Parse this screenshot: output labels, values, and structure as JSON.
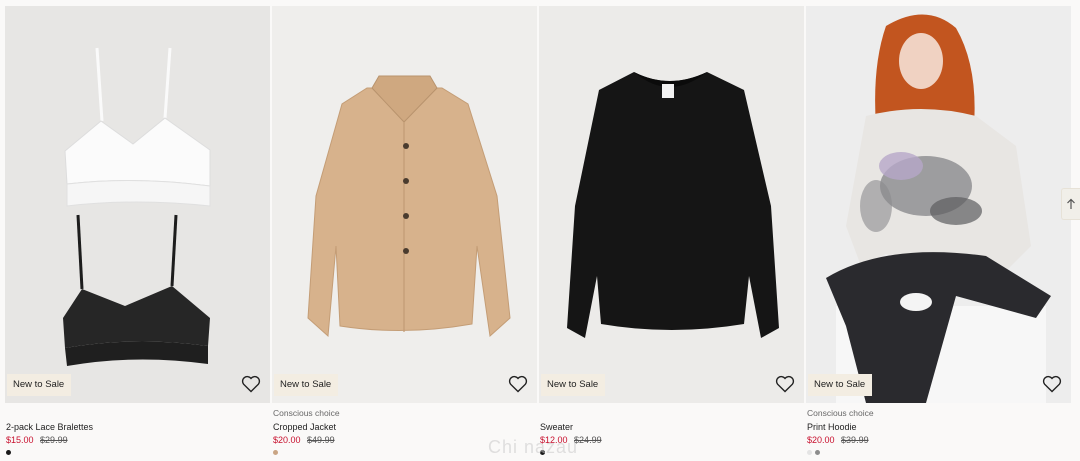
{
  "products": [
    {
      "badge": "New to Sale",
      "tag": "",
      "name": "2-pack Lace Bralettes",
      "price": "$15.00",
      "old_price": "$29.99",
      "swatches": [
        "#1a1a1a"
      ],
      "image_bg": "#e7e6e4"
    },
    {
      "badge": "New to Sale",
      "tag": "Conscious choice",
      "name": "Cropped Jacket",
      "price": "$20.00",
      "old_price": "$49.99",
      "swatches": [
        "#c9a584"
      ],
      "image_bg": "#efeeec"
    },
    {
      "badge": "New to Sale",
      "tag": "",
      "name": "Sweater",
      "price": "$12.00",
      "old_price": "$24.99",
      "swatches": [
        "#1a1a1a"
      ],
      "image_bg": "#ecebe9"
    },
    {
      "badge": "New to Sale",
      "tag": "Conscious choice",
      "name": "Print Hoodie",
      "price": "$20.00",
      "old_price": "$39.99",
      "swatches": [
        "#e4e4e4",
        "#8c8c8c"
      ],
      "image_bg": "#ededed"
    }
  ],
  "favorite_icon": "heart-icon",
  "scroll_top_icon": "arrow-up-icon",
  "watermark": "Chi  nazau"
}
